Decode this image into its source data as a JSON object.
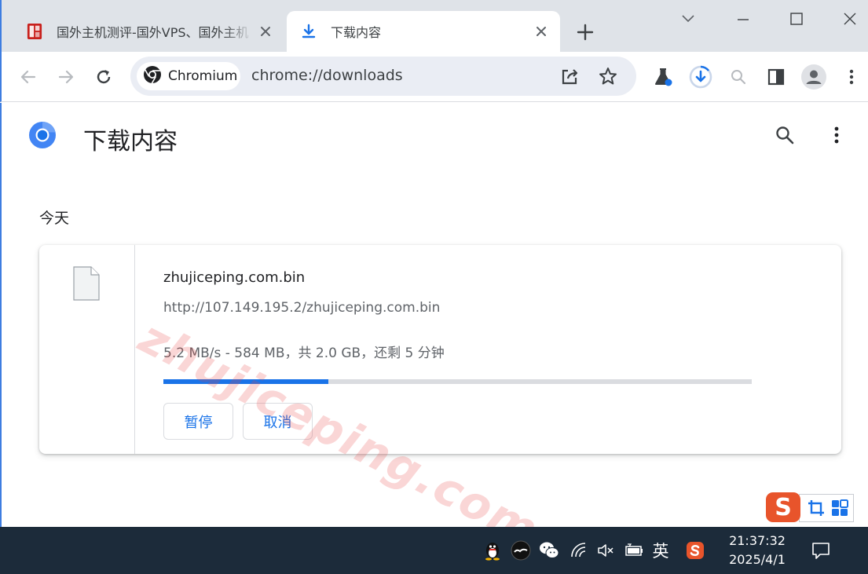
{
  "tabs": [
    {
      "title": "国外主机测评-国外VPS、国外主机",
      "active": false,
      "favicon": "site-logo-icon"
    },
    {
      "title": "下载内容",
      "active": true,
      "favicon": "download-icon"
    }
  ],
  "omnibox": {
    "chip_label": "Chromium",
    "url": "chrome://downloads"
  },
  "page": {
    "title": "下载内容",
    "section_label": "今天"
  },
  "download": {
    "filename": "zhujiceping.com.bin",
    "url": "http://107.149.195.2/zhujiceping.com.bin",
    "status": "5.2 MB/s - 584 MB，共 2.0 GB，还剩 5 分钟",
    "progress_percent": 28,
    "pause_label": "暂停",
    "cancel_label": "取消"
  },
  "watermark": "zhujiceping.com",
  "ime": {
    "logo": "S"
  },
  "taskbar": {
    "ime_lang": "英",
    "time": "21:37:32",
    "date": "2025/4/1"
  },
  "colors": {
    "accent": "#1a73e8",
    "tabstrip": "#dfe3e8",
    "omnibox": "#eaedf4",
    "taskbar": "#1c2b3a",
    "ime": "#e8542b"
  }
}
